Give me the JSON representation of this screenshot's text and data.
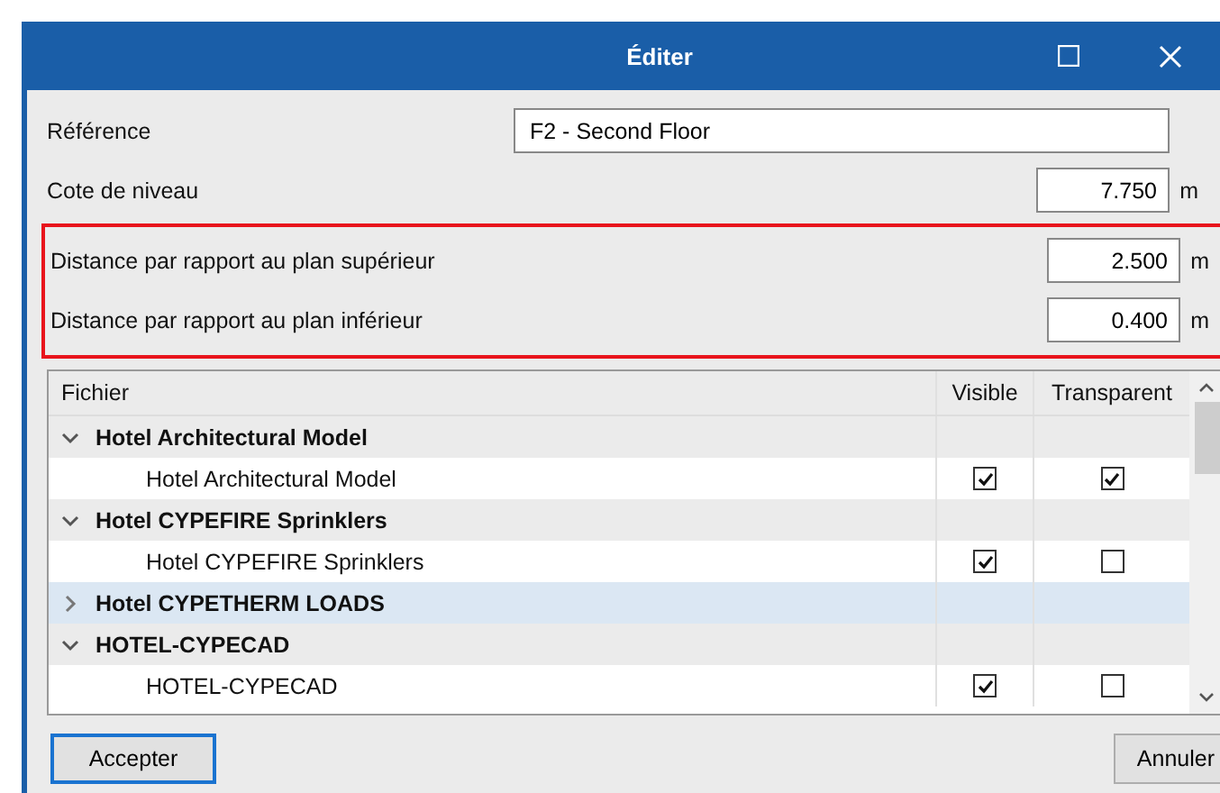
{
  "window": {
    "title": "Éditer"
  },
  "fields": [
    {
      "label": "Référence",
      "value": "F2 - Second Floor",
      "kind": "text",
      "highlighted": false
    },
    {
      "label": "Cote de niveau",
      "value": "7.750",
      "unit": "m",
      "kind": "number",
      "highlighted": false
    },
    {
      "label": "Distance par rapport au plan supérieur",
      "value": "2.500",
      "unit": "m",
      "kind": "number",
      "highlighted": true
    },
    {
      "label": "Distance par rapport au plan inférieur",
      "value": "0.400",
      "unit": "m",
      "kind": "number",
      "highlighted": true
    }
  ],
  "table": {
    "columns": [
      "Fichier",
      "Visible",
      "Transparent"
    ],
    "rows": [
      {
        "label": "Hotel Architectural Model",
        "expanded": true,
        "selected": false,
        "children": [
          {
            "label": "Hotel Architectural Model",
            "visible": true,
            "transparent": true
          }
        ]
      },
      {
        "label": "Hotel CYPEFIRE Sprinklers",
        "expanded": true,
        "selected": false,
        "children": [
          {
            "label": "Hotel CYPEFIRE Sprinklers",
            "visible": true,
            "transparent": false
          }
        ]
      },
      {
        "label": "Hotel CYPETHERM LOADS",
        "expanded": false,
        "selected": true
      },
      {
        "label": "HOTEL-CYPECAD",
        "expanded": true,
        "selected": false,
        "children": [
          {
            "label": "HOTEL-CYPECAD",
            "visible": true,
            "transparent": false
          }
        ]
      }
    ]
  },
  "buttons": [
    {
      "label": "Accepter",
      "kind": "default"
    },
    {
      "label": "Annuler",
      "kind": "normal"
    }
  ]
}
